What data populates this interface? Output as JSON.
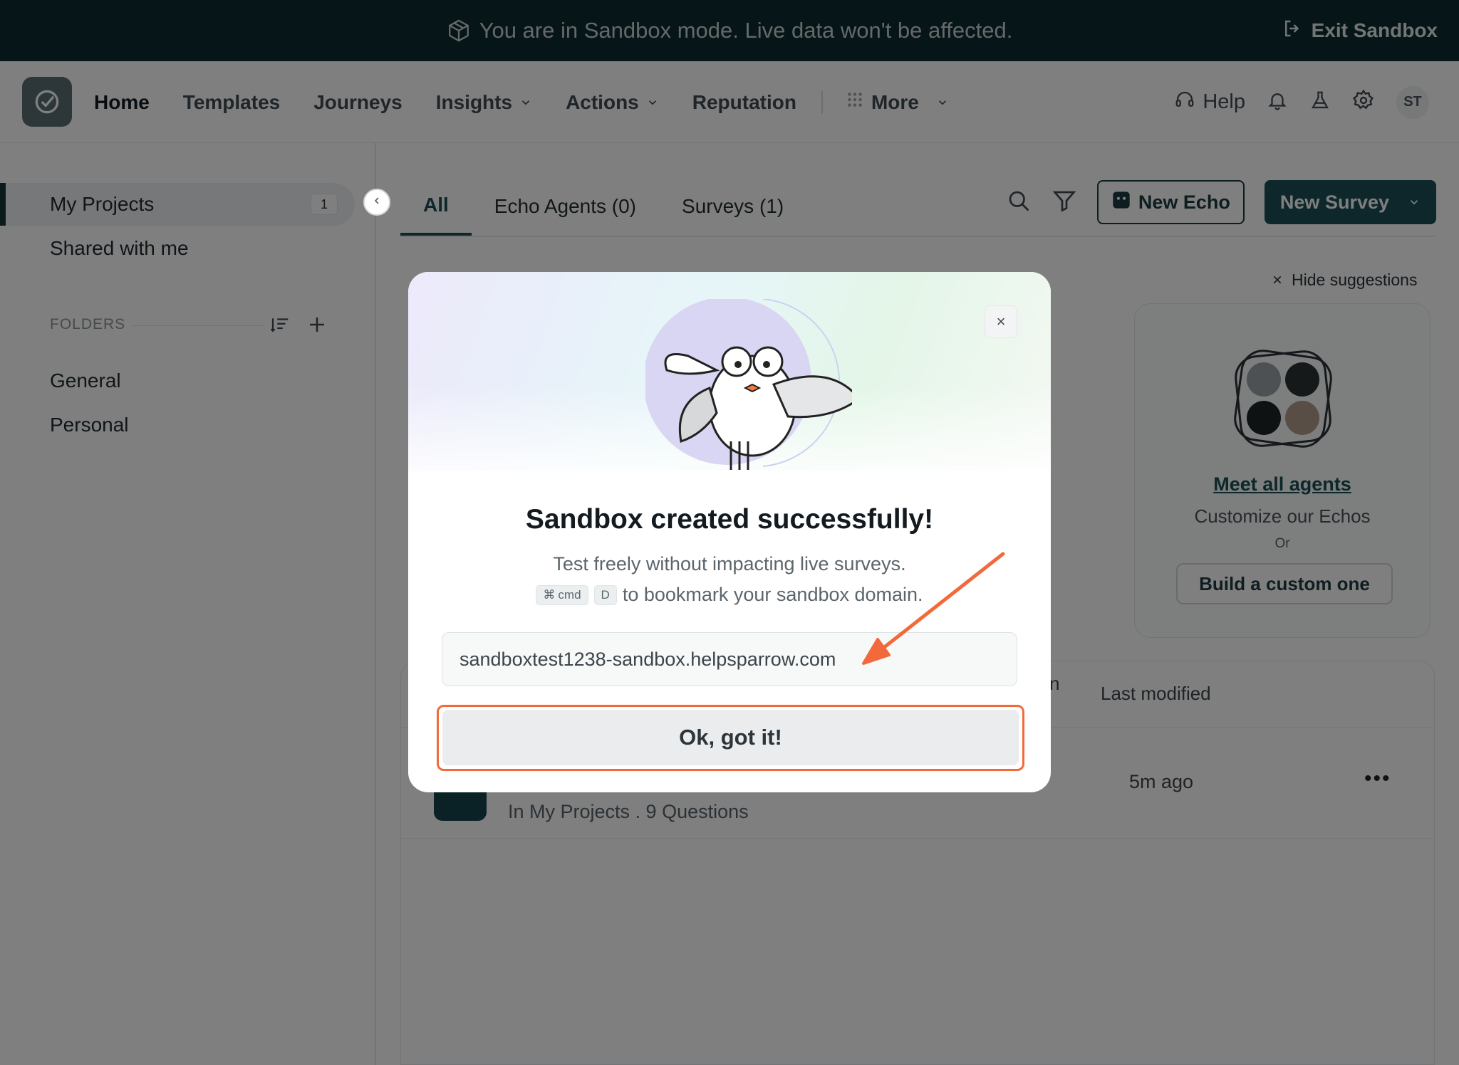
{
  "banner": {
    "message": "You are in Sandbox mode. Live data won't be affected.",
    "exit_label": "Exit Sandbox"
  },
  "nav": {
    "items": [
      {
        "label": "Home"
      },
      {
        "label": "Templates"
      },
      {
        "label": "Journeys"
      },
      {
        "label": "Insights"
      },
      {
        "label": "Actions"
      },
      {
        "label": "Reputation"
      },
      {
        "label": "More"
      }
    ],
    "help_label": "Help",
    "avatar_initials": "ST"
  },
  "sidebar": {
    "my_projects": "My Projects",
    "my_projects_count": "1",
    "shared": "Shared with me",
    "folders_label": "FOLDERS",
    "folders": [
      "General",
      "Personal"
    ]
  },
  "tabs": {
    "all": "All",
    "echo_agents": "Echo Agents (0)",
    "surveys": "Surveys (1)"
  },
  "toolbar": {
    "new_echo": "New Echo",
    "new_survey": "New Survey"
  },
  "suggestions": {
    "hide_label": "Hide suggestions",
    "meet_all": "Meet all agents",
    "customize": "Customize our Echos",
    "or": "Or",
    "build_custom": "Build a custom one"
  },
  "table": {
    "col_partial": "n",
    "col_last_modified": "Last modified",
    "row_meta": "In My Projects . 9 Questions",
    "row_time": "5m ago",
    "row_menu": "•••"
  },
  "modal": {
    "title": "Sandbox created successfully!",
    "subtitle": "Test freely without impacting live surveys.",
    "kbd_cmd": "cmd",
    "kbd_cmd_symbol": "⌘",
    "kbd_d": "D",
    "bookmark_text": "to bookmark your sandbox domain.",
    "domain": "sandboxtest1238-sandbox.helpsparrow.com",
    "ok_label": "Ok, got it!",
    "close_symbol": "×"
  },
  "colors": {
    "accent": "#1a4e57",
    "banner_bg": "#0c2a2e",
    "highlight": "#f26a3b"
  }
}
